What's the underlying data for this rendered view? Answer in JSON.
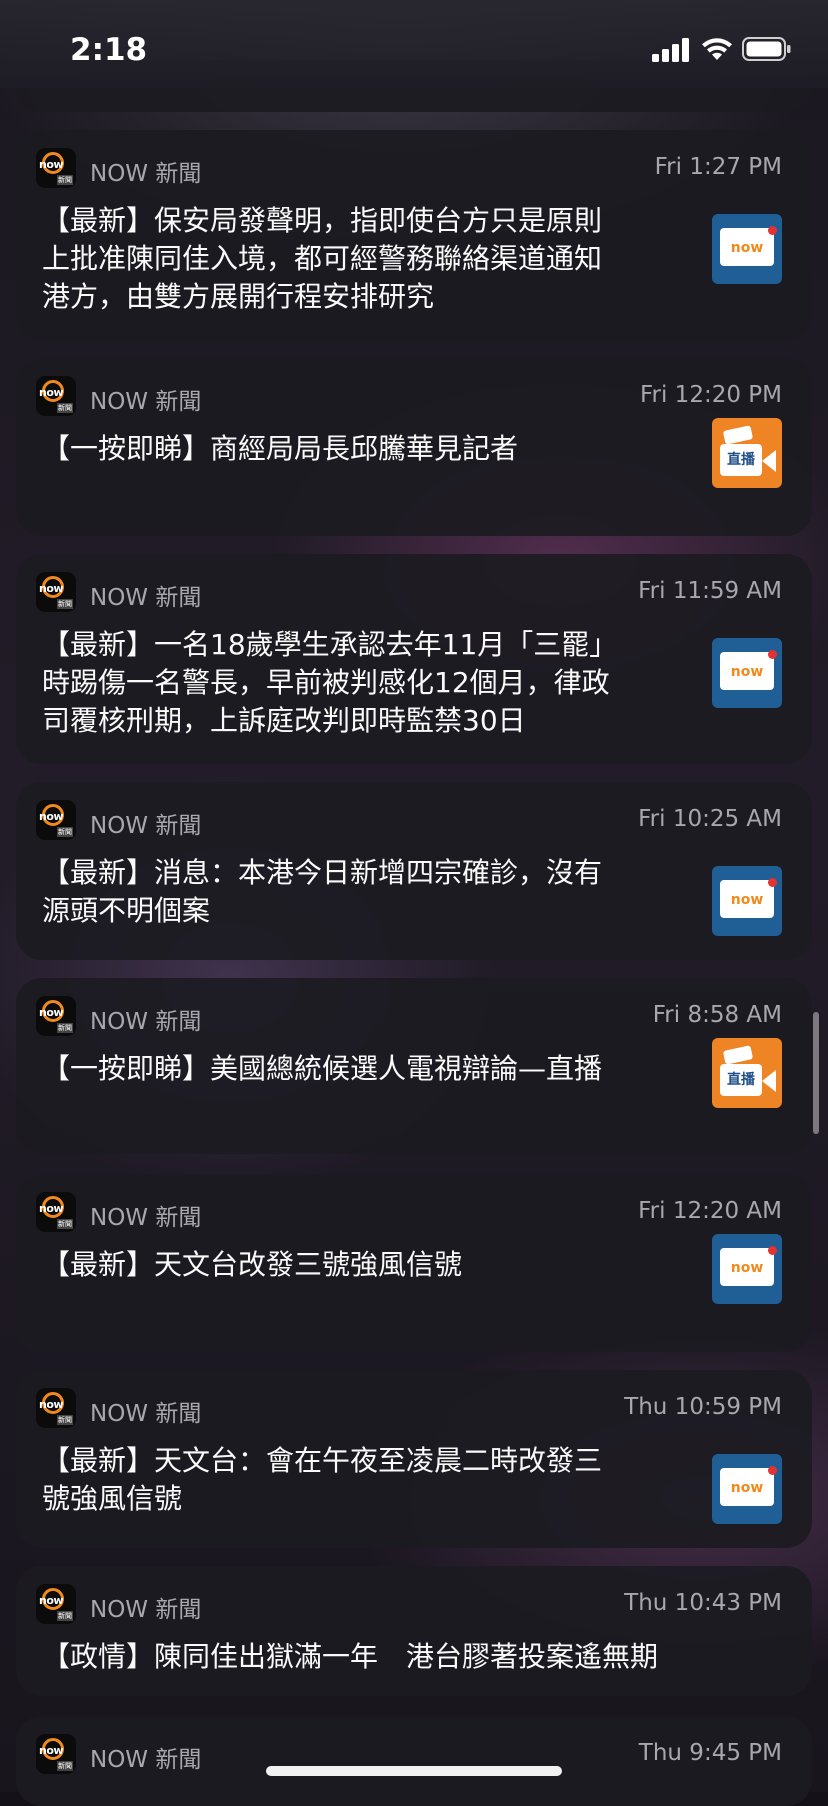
{
  "status_bar": {
    "time": "2:18"
  },
  "notifications": [
    {
      "app": "NOW 新聞",
      "time": "Fri 1:27 PM",
      "lines": [
        "【最新】保安局發聲明，指即使台方只是原則",
        "上批准陳同佳入境，都可經警務聯絡渠道通知",
        "港方，由雙方展開行程安排研究"
      ],
      "thumb": "now-news-icon"
    },
    {
      "app": "NOW 新聞",
      "time": "Fri 12:20 PM",
      "lines": [
        "【一按即睇】商經局局長邱騰華見記者"
      ],
      "thumb": "live-broadcast-icon",
      "thumb_label": "直播"
    },
    {
      "app": "NOW 新聞",
      "time": "Fri 11:59 AM",
      "lines": [
        "【最新】一名18歲學生承認去年11月「三罷」",
        "時踢傷一名警長，早前被判感化12個月，律政",
        "司覆核刑期，上訴庭改判即時監禁30日"
      ],
      "thumb": "now-news-icon"
    },
    {
      "app": "NOW 新聞",
      "time": "Fri 10:25 AM",
      "lines": [
        "【最新】消息：本港今日新增四宗確診，沒有",
        "源頭不明個案"
      ],
      "thumb": "now-news-icon"
    },
    {
      "app": "NOW 新聞",
      "time": "Fri 8:58 AM",
      "lines": [
        "【一按即睇】美國總統候選人電視辯論—直播"
      ],
      "thumb": "live-broadcast-icon",
      "thumb_label": "直播"
    },
    {
      "app": "NOW 新聞",
      "time": "Fri 12:20 AM",
      "lines": [
        "【最新】天文台改發三號強風信號"
      ],
      "thumb": "now-news-icon"
    },
    {
      "app": "NOW 新聞",
      "time": "Thu 10:59 PM",
      "lines": [
        "【最新】天文台：會在午夜至凌晨二時改發三",
        "號強風信號"
      ],
      "thumb": "now-news-icon"
    },
    {
      "app": "NOW 新聞",
      "time": "Thu 10:43 PM",
      "lines": [
        "【政情】陳同佳出獄滿一年　港台膠著投案遙無期"
      ]
    },
    {
      "app": "NOW 新聞",
      "time": "Thu 9:45 PM",
      "lines": []
    }
  ],
  "app_icon_text": {
    "brand": "now",
    "tag": "新聞"
  },
  "thumb_brand": "now"
}
